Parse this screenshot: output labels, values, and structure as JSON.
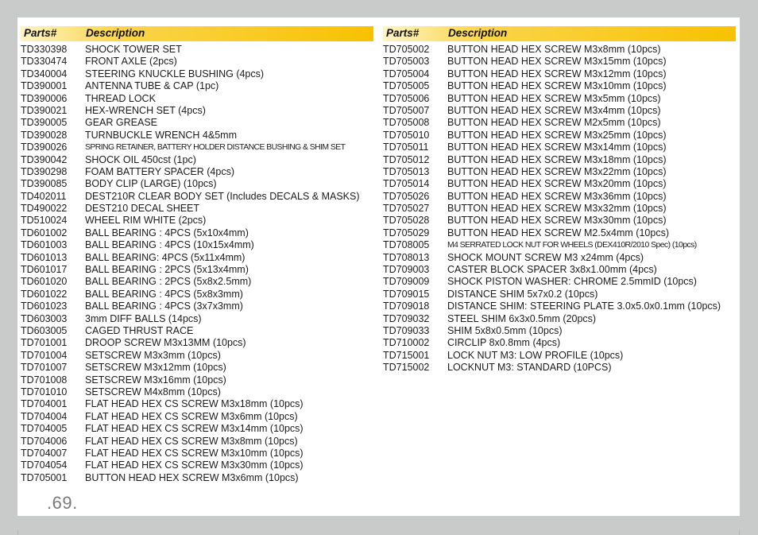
{
  "header": {
    "parts_label": "Parts#",
    "description_label": "Description"
  },
  "left_parts": [
    {
      "part": "TD330398",
      "desc": "SHOCK TOWER SET"
    },
    {
      "part": "TD330474",
      "desc": "FRONT AXLE (2pcs)"
    },
    {
      "part": "TD340004",
      "desc": "STEERING KNUCKLE BUSHING (4pcs)"
    },
    {
      "part": "TD390001",
      "desc": "ANTENNA TUBE & CAP (1pc)"
    },
    {
      "part": "TD390006",
      "desc": "THREAD LOCK"
    },
    {
      "part": "TD390021",
      "desc": "HEX-WRENCH SET (4pcs)"
    },
    {
      "part": "TD390005",
      "desc": "GEAR GREASE"
    },
    {
      "part": "TD390028",
      "desc": "TURNBUCKLE WRENCH 4&5mm"
    },
    {
      "part": "TD390026",
      "desc": "SPRING RETAINER, BATTERY HOLDER DISTANCE BUSHING & SHIM SET",
      "condensed": true
    },
    {
      "part": "TD390042",
      "desc": "SHOCK OIL 450cst (1pc)"
    },
    {
      "part": "TD390298",
      "desc": "FOAM BATTERY SPACER (4pcs)"
    },
    {
      "part": "TD390085",
      "desc": "BODY CLIP (LARGE) (10pcs)"
    },
    {
      "part": "TD402011",
      "desc": "DEST210R CLEAR BODY SET (Includes DECALS & MASKS)"
    },
    {
      "part": "TD490022",
      "desc": "DEST210 DECAL SHEET"
    },
    {
      "part": "TD510024",
      "desc": "WHEEL RIM WHITE (2pcs)"
    },
    {
      "part": "TD601002",
      "desc": "BALL BEARING : 4PCS (5x10x4mm)"
    },
    {
      "part": "TD601003",
      "desc": "BALL BEARING : 4PCS (10x15x4mm)"
    },
    {
      "part": "TD601013",
      "desc": "BALL BEARING: 4PCS (5x11x4mm)"
    },
    {
      "part": "TD601017",
      "desc": "BALL BEARING : 2PCS (5x13x4mm)"
    },
    {
      "part": "TD601020",
      "desc": "BALL BEARING : 2PCS (5x8x2.5mm)"
    },
    {
      "part": "TD601022",
      "desc": "BALL BEARING : 4PCS (5x8x3mm)"
    },
    {
      "part": "TD601023",
      "desc": "BALL BEARING : 4PCS (3x7x3mm)"
    },
    {
      "part": "TD603003",
      "desc": "3mm DIFF BALLS (14pcs)"
    },
    {
      "part": "TD603005",
      "desc": "CAGED THRUST RACE"
    },
    {
      "part": "TD701001",
      "desc": "DROOP SCREW M3x13MM (10pcs)"
    },
    {
      "part": "TD701004",
      "desc": "SETSCREW M3x3mm (10pcs)"
    },
    {
      "part": "TD701007",
      "desc": "SETSCREW M3x12mm (10pcs)"
    },
    {
      "part": "TD701008",
      "desc": "SETSCREW M3x16mm (10pcs)"
    },
    {
      "part": "TD701010",
      "desc": "SETSCREW M4x8mm (10pcs)"
    },
    {
      "part": "TD704001",
      "desc": "FLAT HEAD HEX CS SCREW M3x18mm (10pcs)"
    },
    {
      "part": "TD704004",
      "desc": "FLAT HEAD HEX CS SCREW M3x6mm (10pcs)"
    },
    {
      "part": "TD704005",
      "desc": "FLAT HEAD HEX CS SCREW M3x14mm (10pcs)"
    },
    {
      "part": "TD704006",
      "desc": "FLAT HEAD HEX CS SCREW M3x8mm (10pcs)"
    },
    {
      "part": "TD704007",
      "desc": "FLAT HEAD HEX CS SCREW M3x10mm (10pcs)"
    },
    {
      "part": "TD704054",
      "desc": "FLAT HEAD HEX CS SCREW M3x30mm (10pcs)"
    },
    {
      "part": "TD705001",
      "desc": "BUTTON HEAD HEX SCREW M3x6mm (10pcs)"
    }
  ],
  "right_parts": [
    {
      "part": "TD705002",
      "desc": "BUTTON HEAD HEX SCREW M3x8mm (10pcs)"
    },
    {
      "part": "TD705003",
      "desc": "BUTTON HEAD HEX SCREW M3x15mm (10pcs)"
    },
    {
      "part": "TD705004",
      "desc": "BUTTON HEAD HEX SCREW M3x12mm (10pcs)"
    },
    {
      "part": "TD705005",
      "desc": "BUTTON HEAD HEX SCREW M3x10mm (10pcs)"
    },
    {
      "part": "TD705006",
      "desc": "BUTTON HEAD HEX SCREW M3x5mm (10pcs)"
    },
    {
      "part": "TD705007",
      "desc": "BUTTON HEAD HEX SCREW M3x4mm (10pcs)"
    },
    {
      "part": "TD705008",
      "desc": "BUTTON HEAD HEX SCREW M2x5mm (10pcs)"
    },
    {
      "part": "TD705010",
      "desc": "BUTTON HEAD HEX SCREW M3x25mm (10pcs)"
    },
    {
      "part": "TD705011",
      "desc": "BUTTON HEAD HEX SCREW M3x14mm (10pcs)"
    },
    {
      "part": "TD705012",
      "desc": "BUTTON HEAD HEX SCREW M3x18mm (10pcs)"
    },
    {
      "part": "TD705013",
      "desc": "BUTTON HEAD HEX SCREW M3x22mm (10pcs)"
    },
    {
      "part": "TD705014",
      "desc": "BUTTON HEAD HEX SCREW M3x20mm (10pcs)"
    },
    {
      "part": "TD705026",
      "desc": "BUTTON HEAD HEX SCREW M3x36mm (10pcs)"
    },
    {
      "part": "TD705027",
      "desc": "BUTTON HEAD HEX SCREW M3x32mm (10pcs)"
    },
    {
      "part": "TD705028",
      "desc": "BUTTON HEAD HEX SCREW M3x30mm (10pcs)"
    },
    {
      "part": "TD705029",
      "desc": "BUTTON HEAD HEX SCREW M2.5x4mm (10pcs)"
    },
    {
      "part": "TD708005",
      "desc": "M4 SERRATED LOCK NUT FOR WHEELS (DEX410R/2010 Spec) (10pcs)",
      "condensed": true
    },
    {
      "part": "TD708013",
      "desc": "SHOCK MOUNT SCREW M3 x24mm (4pcs)"
    },
    {
      "part": "TD709003",
      "desc": "CASTER BLOCK SPACER 3x8x1.00mm (4pcs)"
    },
    {
      "part": "TD709009",
      "desc": "SHOCK PISTON WASHER: CHROME 2.5mmID (10pcs)"
    },
    {
      "part": "TD709015",
      "desc": "DISTANCE SHIM 5x7x0.2 (10pcs)"
    },
    {
      "part": "TD709018",
      "desc": "DISTANCE SHIM: STEERING PLATE 3.0x5.0x0.1mm (10pcs)"
    },
    {
      "part": "TD709032",
      "desc": "STEEL SHIM 6x3x0.5mm (20pcs)"
    },
    {
      "part": "TD709033",
      "desc": "SHIM 5x8x0.5mm (10pcs)"
    },
    {
      "part": "TD710002",
      "desc": "CIRCLIP 8x0.8mm (4pcs)"
    },
    {
      "part": "TD715001",
      "desc": "LOCK NUT M3: LOW PROFILE (10pcs)"
    },
    {
      "part": "TD715002",
      "desc": "LOCKNUT M3: STANDARD (10PCS)"
    }
  ],
  "page_number": ".69."
}
